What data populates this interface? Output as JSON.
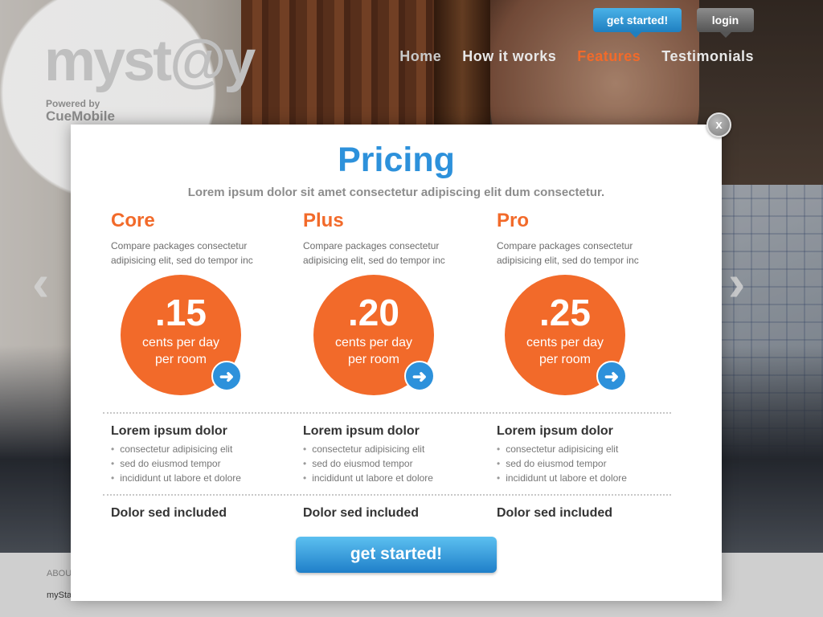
{
  "brand": {
    "logo_text": "myst@y",
    "powered_by": "Powered by",
    "company": "CueMobile"
  },
  "top_buttons": {
    "get_started": "get started!",
    "login": "login"
  },
  "nav": {
    "items": [
      {
        "label": "Home",
        "state": "muted"
      },
      {
        "label": "How it works",
        "state": "normal"
      },
      {
        "label": "Features",
        "state": "active"
      },
      {
        "label": "Testimonials",
        "state": "normal"
      }
    ]
  },
  "carousel": {
    "prev_icon": "‹",
    "next_icon": "›"
  },
  "footer": {
    "about": "ABOU",
    "brand": "mySta",
    "plus_icon": "+"
  },
  "modal": {
    "close_label": "x",
    "title": "Pricing",
    "subtitle": "Lorem ipsum dolor sit amet consectetur adipiscing elit dum consectetur.",
    "plans": [
      {
        "name": "Core",
        "description": "Compare packages consectetur adipisicing elit, sed do tempor inc",
        "price": ".15",
        "unit_line1": "cents per day",
        "unit_line2": "per room",
        "feature_heading": "Lorem ipsum dolor",
        "features": [
          "consectetur adipisicing elit",
          "sed do eiusmod tempor",
          "incididunt ut labore et dolore"
        ],
        "included": "Dolor sed included"
      },
      {
        "name": "Plus",
        "description": "Compare packages consectetur adipisicing elit, sed do tempor inc",
        "price": ".20",
        "unit_line1": "cents per day",
        "unit_line2": "per room",
        "feature_heading": "Lorem ipsum dolor",
        "features": [
          "consectetur adipisicing elit",
          "sed do eiusmod tempor",
          "incididunt ut labore et dolore"
        ],
        "included": "Dolor sed included"
      },
      {
        "name": "Pro",
        "description": "Compare packages consectetur adipisicing elit, sed do tempor inc",
        "price": ".25",
        "unit_line1": "cents per day",
        "unit_line2": "per room",
        "feature_heading": "Lorem ipsum dolor",
        "features": [
          "consectetur adipisicing elit",
          "sed do eiusmod tempor",
          "incididunt ut labore et dolore"
        ],
        "included": "Dolor sed included"
      }
    ],
    "arrow_icon": "➜",
    "cta": "get started!"
  },
  "colors": {
    "accent_orange": "#f26a2a",
    "accent_blue": "#2d91db"
  }
}
